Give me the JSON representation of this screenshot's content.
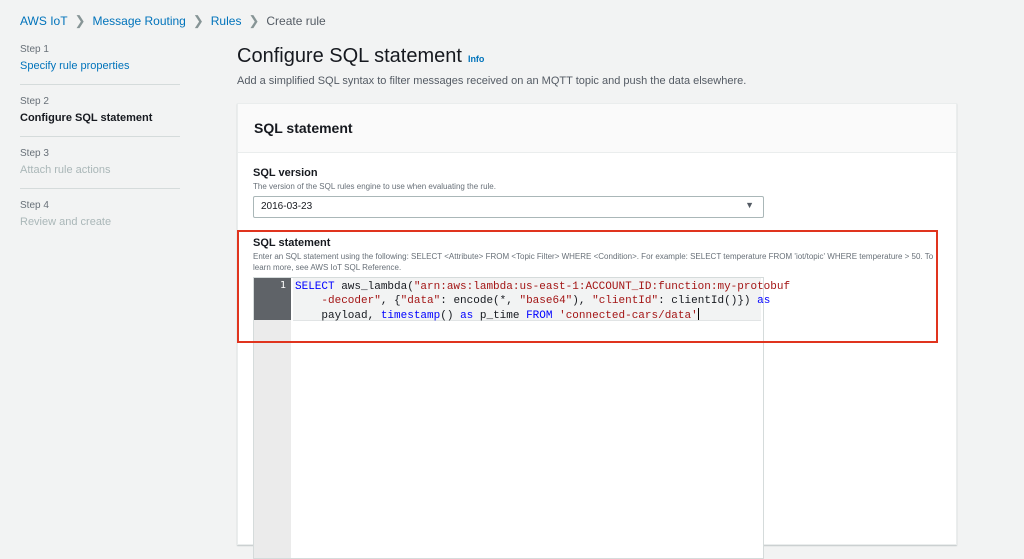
{
  "breadcrumb": {
    "items": [
      "AWS IoT",
      "Message Routing",
      "Rules"
    ],
    "current": "Create rule"
  },
  "steps": [
    {
      "label": "Step 1",
      "title": "Specify rule properties",
      "state": "link"
    },
    {
      "label": "Step 2",
      "title": "Configure SQL statement",
      "state": "current"
    },
    {
      "label": "Step 3",
      "title": "Attach rule actions",
      "state": "disabled"
    },
    {
      "label": "Step 4",
      "title": "Review and create",
      "state": "disabled"
    }
  ],
  "page": {
    "title": "Configure SQL statement",
    "info_link": "Info",
    "description": "Add a simplified SQL syntax to filter messages received on an MQTT topic and push the data elsewhere."
  },
  "panel": {
    "title": "SQL statement",
    "sql_version": {
      "label": "SQL version",
      "description": "The version of the SQL rules engine to use when evaluating the rule.",
      "value": "2016-03-23"
    },
    "sql_statement": {
      "label": "SQL statement",
      "description": "Enter an SQL statement using the following: SELECT <Attribute> FROM <Topic Filter> WHERE <Condition>. For example: SELECT temperature FROM 'iot/topic' WHERE temperature > 50. To learn more, see AWS IoT SQL Reference."
    }
  },
  "editor": {
    "line_number": "1",
    "tokens": {
      "select": "SELECT",
      "fn": " aws_lambda(",
      "arn": "\"arn:aws:lambda:us-east-1:ACCOUNT_ID:function:my-protobuf",
      "arn_cont": "-decoder\"",
      "p1": ", {",
      "data_key": "\"data\"",
      "p2": ": encode(*, ",
      "b64": "\"base64\"",
      "p3": "), ",
      "cid_key": "\"clientId\"",
      "p4": ": clientId()}) ",
      "as1": "as",
      "payload": "payload, ",
      "timestamp": "timestamp",
      "p5": "() ",
      "as2": "as",
      "p6": " p_time ",
      "from": "FROM",
      "topic": "'connected-cars/data'"
    }
  },
  "colors": {
    "link": "#0073bb",
    "highlight": "#e0341e",
    "keyword": "#0000ff",
    "string": "#a31515"
  }
}
